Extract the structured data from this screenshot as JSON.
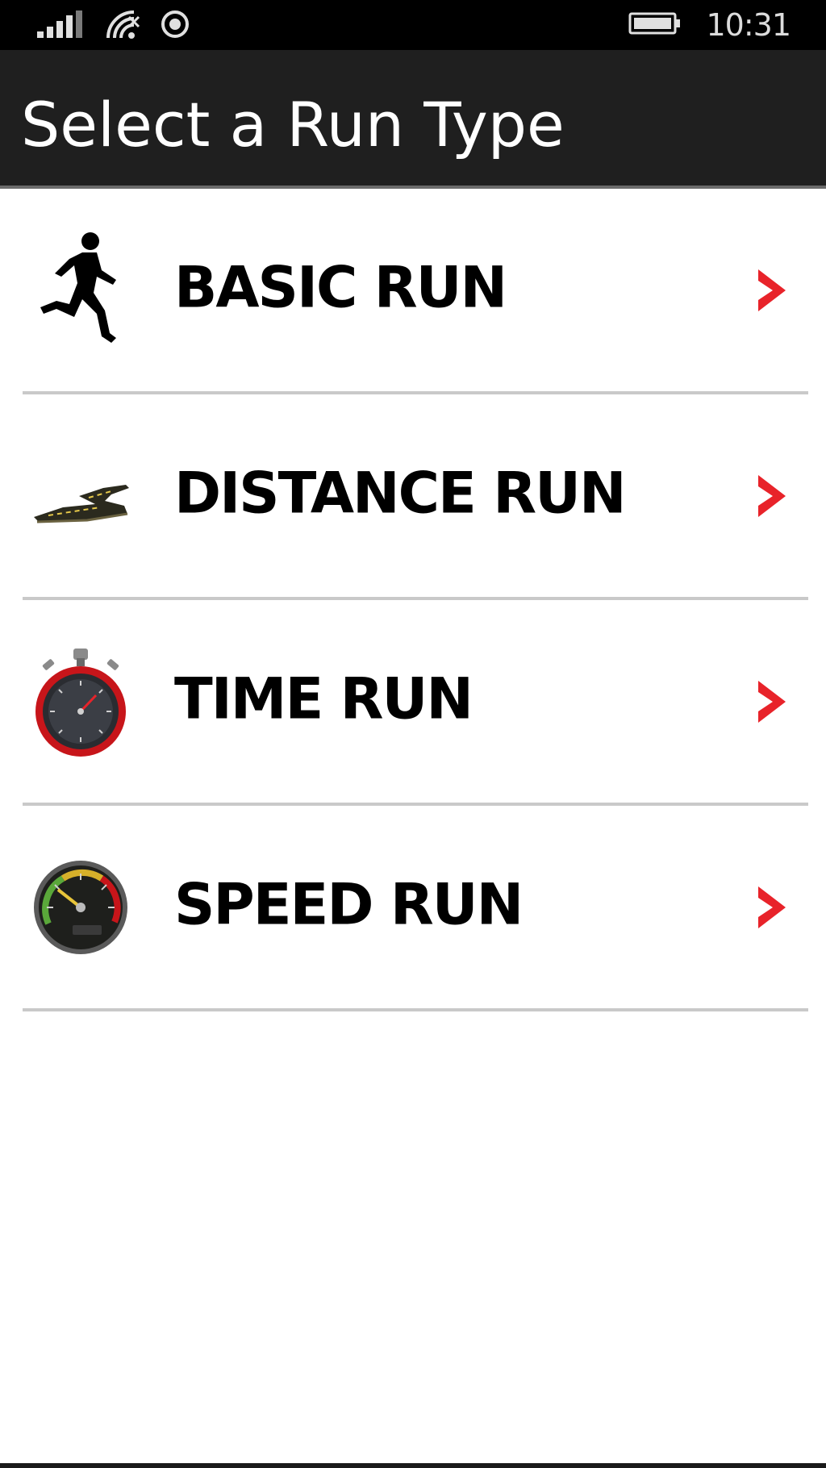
{
  "status_bar": {
    "time": "10:31",
    "icons": [
      "signal-icon",
      "wifi-icon",
      "location-icon",
      "battery-icon"
    ]
  },
  "header": {
    "title": "Select a Run Type"
  },
  "run_types": [
    {
      "label": "BASIC RUN",
      "icon": "runner-icon"
    },
    {
      "label": "DISTANCE RUN",
      "icon": "road-icon"
    },
    {
      "label": "TIME RUN",
      "icon": "stopwatch-icon"
    },
    {
      "label": "SPEED RUN",
      "icon": "speedometer-icon"
    }
  ],
  "colors": {
    "status_bar_bg": "#000000",
    "title_bar_bg": "#1f1f1f",
    "chevron": "#e8232a",
    "divider": "#c9c9c9",
    "label": "#000000"
  }
}
